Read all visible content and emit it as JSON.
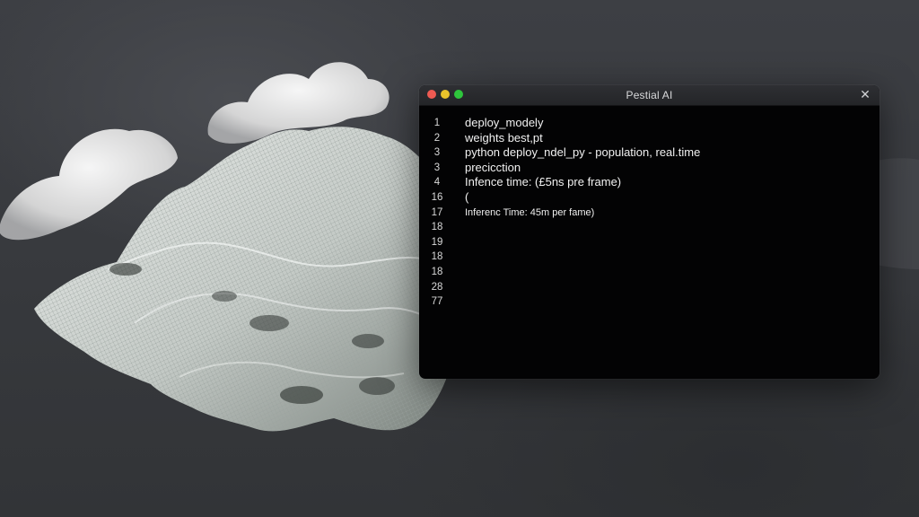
{
  "window": {
    "title": "Pestial AI",
    "close_glyph": "✕",
    "controls": {
      "close_color": "#ee5a52",
      "minimize_color": "#e8c22b",
      "zoom_color": "#2ec53c"
    }
  },
  "editor": {
    "lines": [
      {
        "number": "1",
        "text": "deploy_modely"
      },
      {
        "number": "2",
        "text": "weights best,pt"
      },
      {
        "number": "3",
        "text": "python deploy_ndel_py - population, real.time"
      },
      {
        "number": "3",
        "text": "precicction"
      },
      {
        "number": "4",
        "text": "Infence time: (£5ns pre frame)"
      },
      {
        "number": "16",
        "text": "("
      },
      {
        "number": "17",
        "text": "Inferenc Time: 45m per fame)"
      },
      {
        "number": "18",
        "text": ""
      },
      {
        "number": "19",
        "text": ""
      },
      {
        "number": "18",
        "text": ""
      },
      {
        "number": "18",
        "text": ""
      },
      {
        "number": "28",
        "text": ""
      },
      {
        "number": "77",
        "text": ""
      }
    ]
  },
  "background": {
    "icons": [
      "cloud-shape",
      "wireframe-terrain"
    ]
  }
}
